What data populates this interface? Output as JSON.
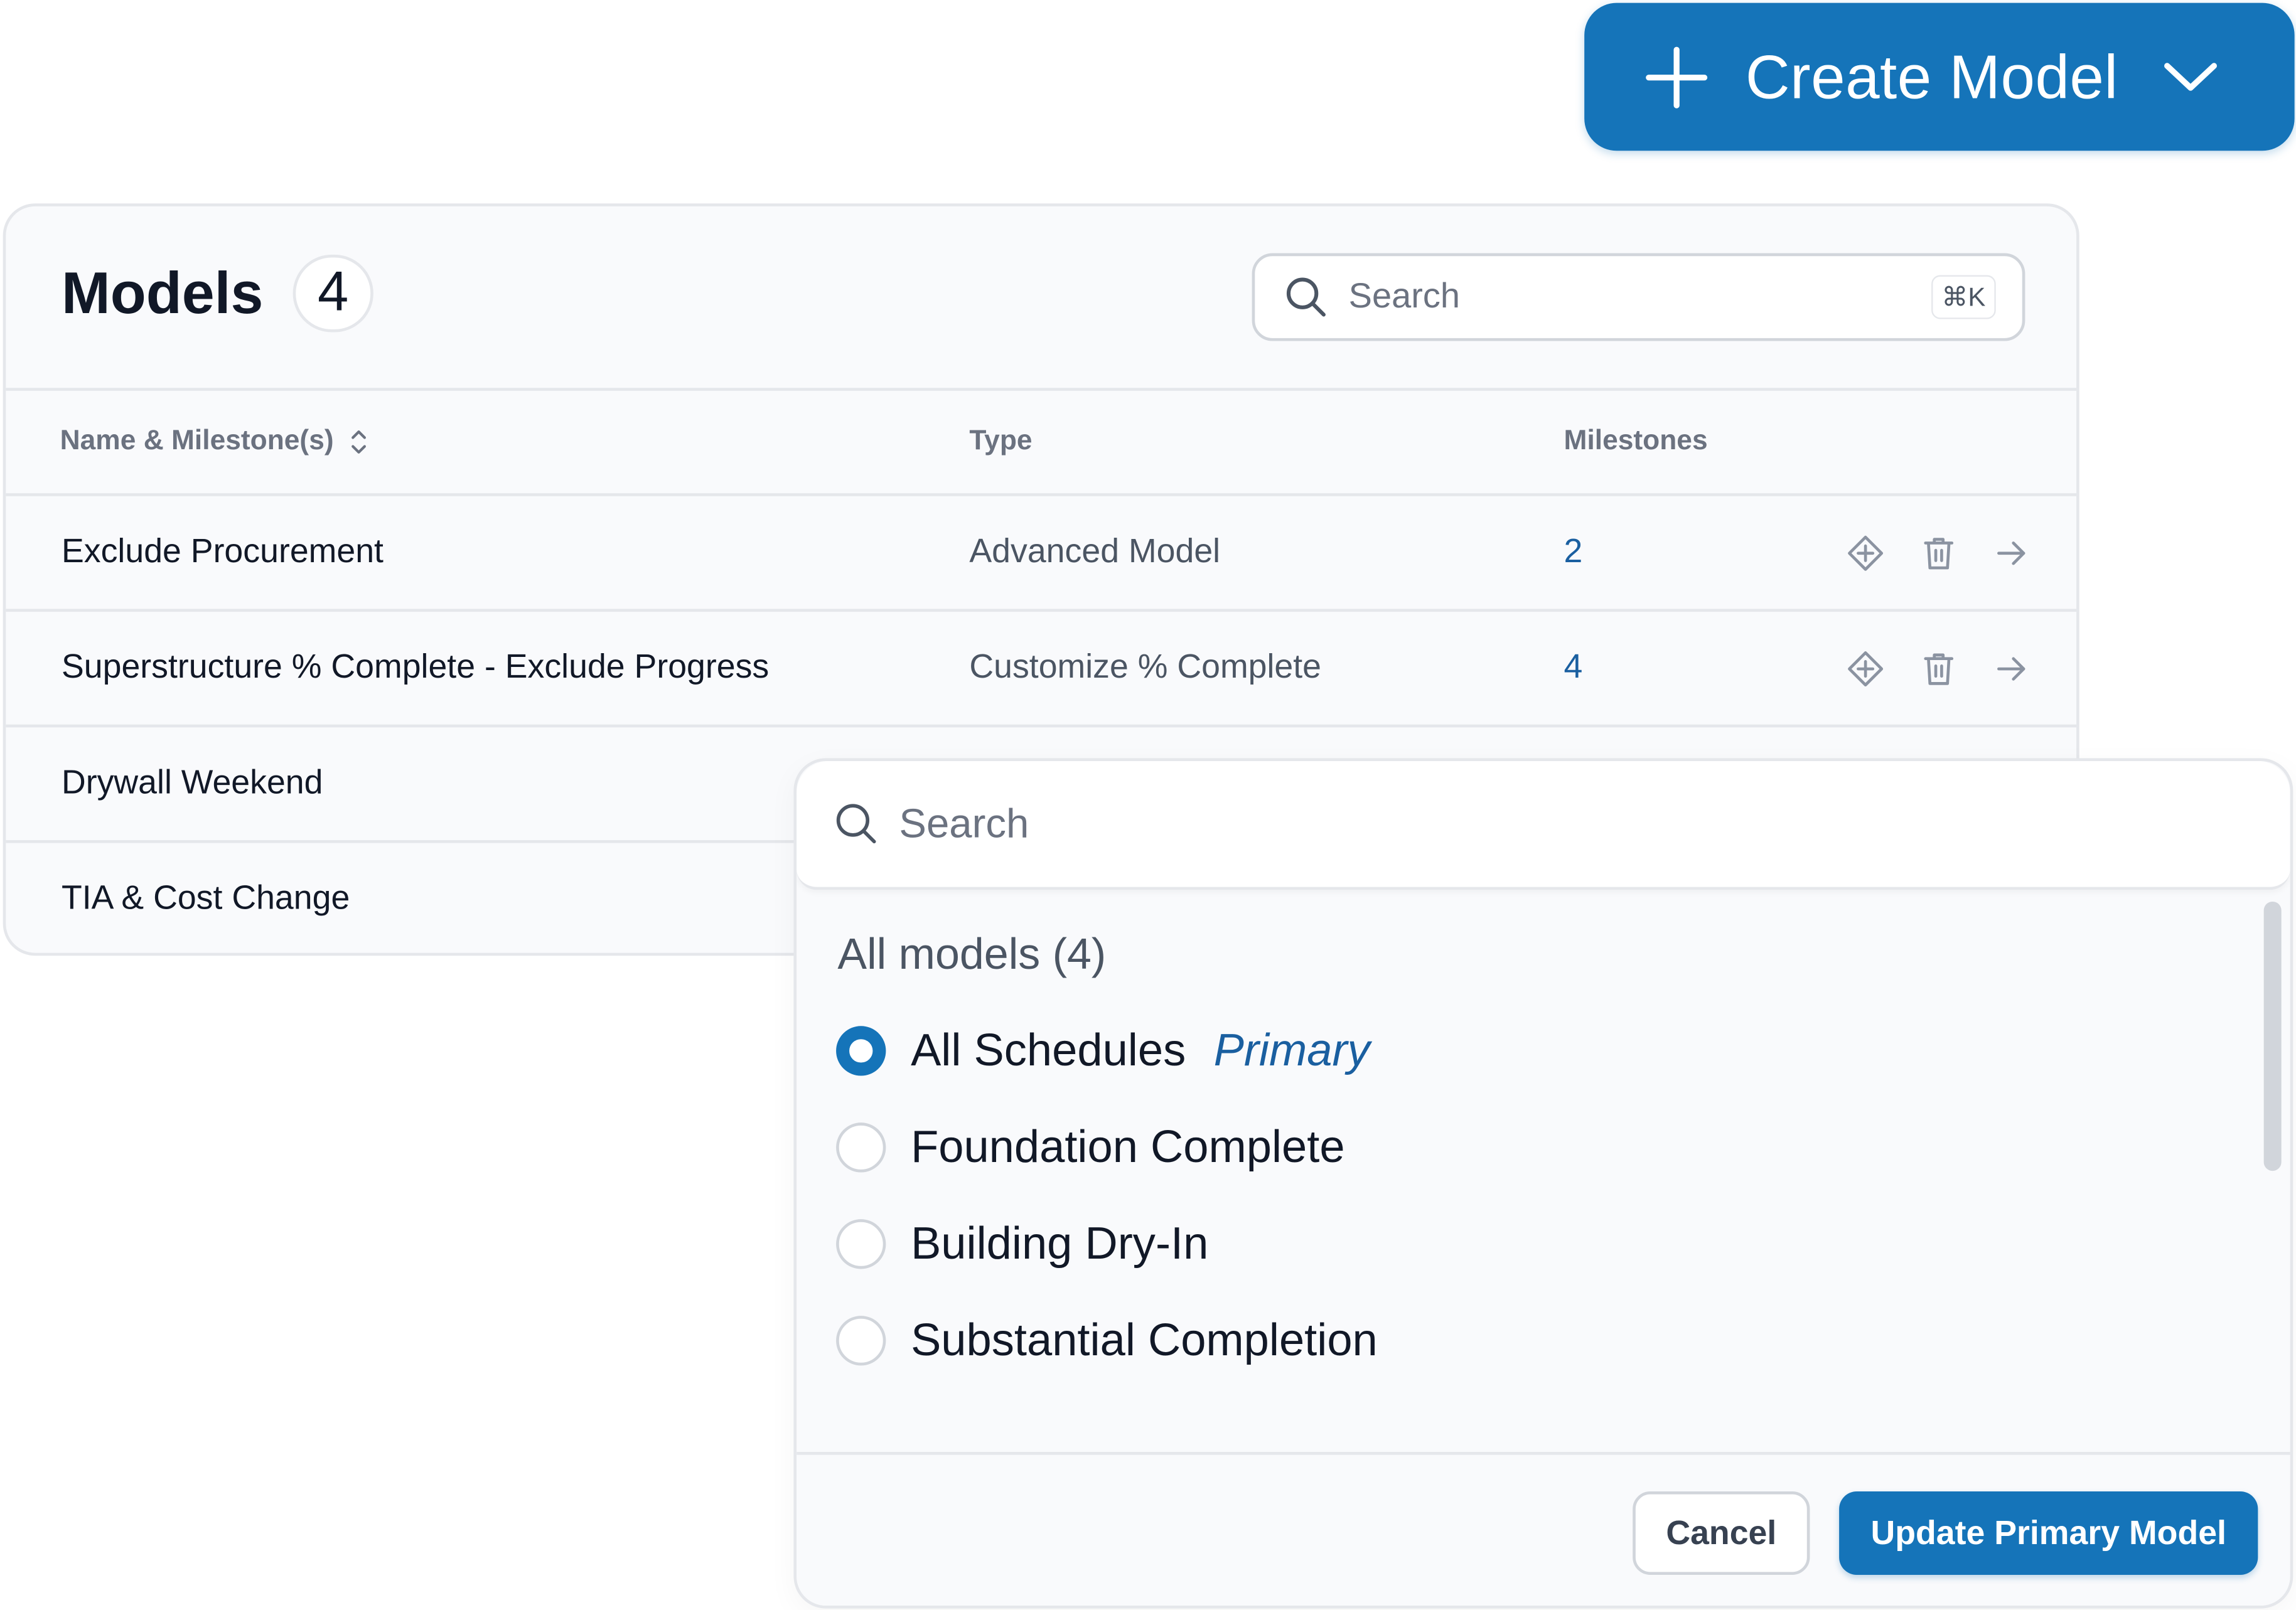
{
  "create_button": {
    "label": "Create Model"
  },
  "models_card": {
    "title": "Models",
    "count": "4",
    "search": {
      "placeholder": "Search",
      "shortcut": "⌘K"
    },
    "columns": [
      "Name & Milestone(s)",
      "Type",
      "Milestones"
    ],
    "rows": [
      {
        "name": "Exclude Procurement",
        "type": "Advanced Model",
        "milestones": "2"
      },
      {
        "name": "Superstructure % Complete - Exclude Progress",
        "type": "Customize % Complete",
        "milestones": "4"
      },
      {
        "name": "Drywall Weekend",
        "type": "",
        "milestones": ""
      },
      {
        "name": "TIA & Cost Change",
        "type": "",
        "milestones": ""
      }
    ],
    "row_actions": [
      "milestone-icon",
      "trash-icon",
      "arrow-right-icon"
    ]
  },
  "popover": {
    "search_placeholder": "Search",
    "group_label": "All models (4)",
    "options": [
      {
        "label": "All Schedules",
        "tag": "Primary",
        "selected": true
      },
      {
        "label": "Foundation Complete",
        "tag": "",
        "selected": false
      },
      {
        "label": "Building Dry-In",
        "tag": "",
        "selected": false
      },
      {
        "label": "Substantial Completion",
        "tag": "",
        "selected": false
      }
    ],
    "cancel_label": "Cancel",
    "update_label": "Update Primary Model"
  },
  "colors": {
    "primary": "#1574b9",
    "link": "#1a5fa0",
    "border": "#e5e7eb",
    "surface": "#f9fafc"
  }
}
